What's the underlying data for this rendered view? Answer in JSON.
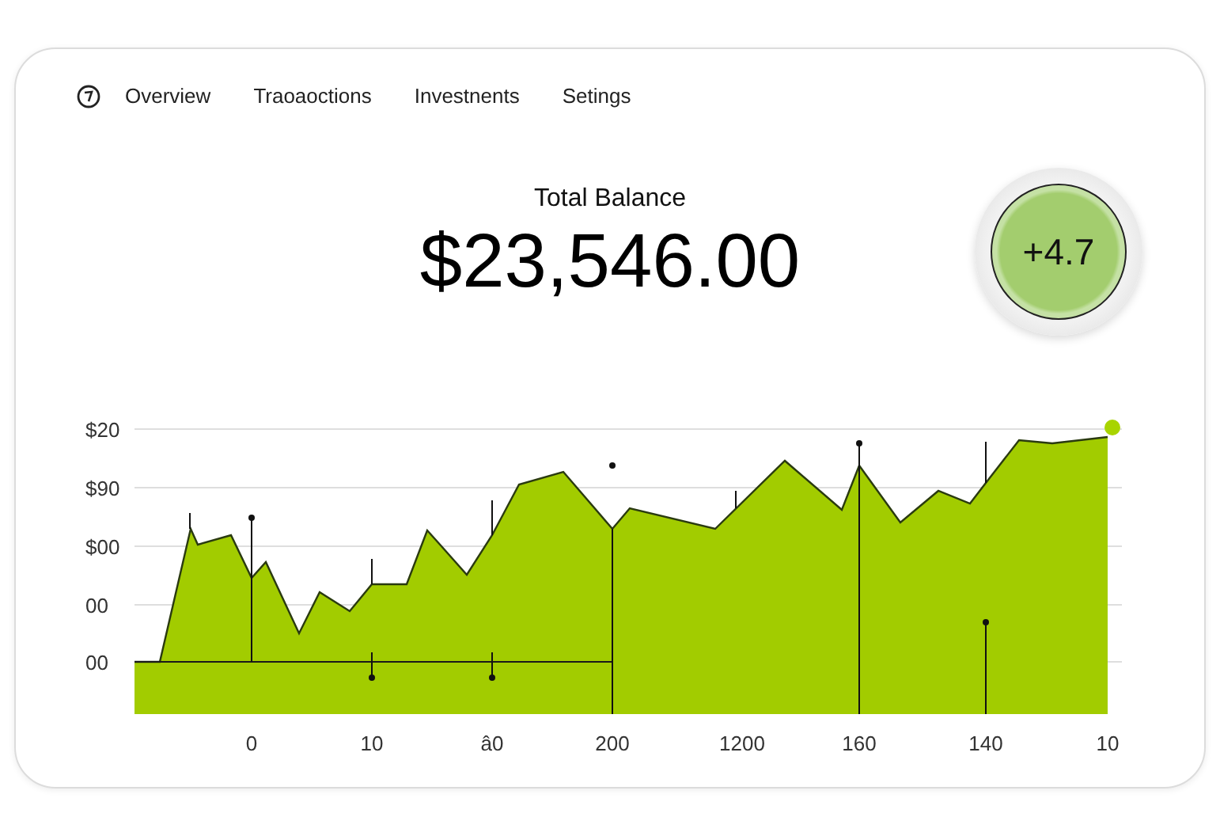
{
  "nav": {
    "items": [
      "Overview",
      "Traoaoctions",
      "Investnents",
      "Setings"
    ]
  },
  "balance": {
    "label": "Total Balance",
    "amount": "$23,546.00"
  },
  "change_badge": {
    "text": "+4.7"
  },
  "chart": {
    "y_labels": [
      "$20",
      "$90",
      "$00",
      "00",
      "00"
    ],
    "x_labels": [
      "0",
      "10",
      "â0",
      "200",
      "1200",
      "160",
      "140",
      "10"
    ]
  }
}
